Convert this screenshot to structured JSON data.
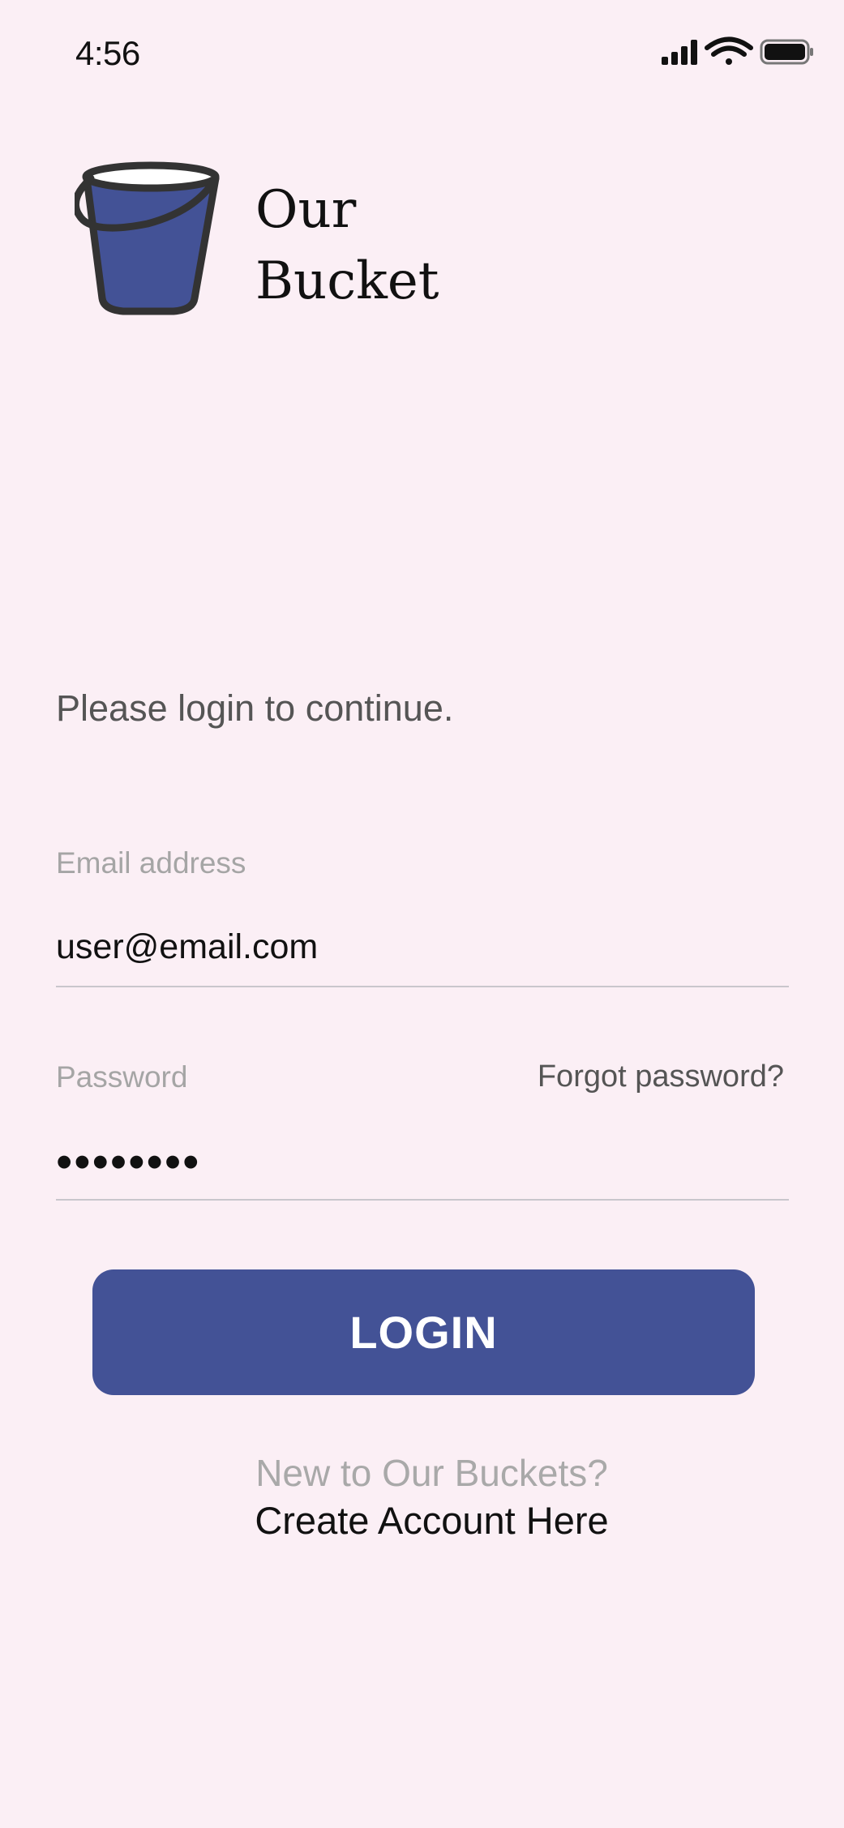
{
  "status_bar": {
    "time": "4:56",
    "icons": [
      "cellular-signal-icon",
      "wifi-icon",
      "battery-icon"
    ]
  },
  "brand": {
    "name_line1": "Our",
    "name_line2": "Bucket",
    "logo_icon": "bucket-icon",
    "logo_color": "#435296"
  },
  "login": {
    "prompt": "Please login to continue.",
    "email_label": "Email address",
    "email_value": "user@email.com",
    "password_label": "Password",
    "password_value": "••••••••",
    "forgot_link": "Forgot password?",
    "login_button": "LOGIN"
  },
  "signup": {
    "prompt": "New to Our Buckets?",
    "link": "Create Account Here"
  },
  "colors": {
    "background": "#fbeff5",
    "accent": "#435296"
  }
}
